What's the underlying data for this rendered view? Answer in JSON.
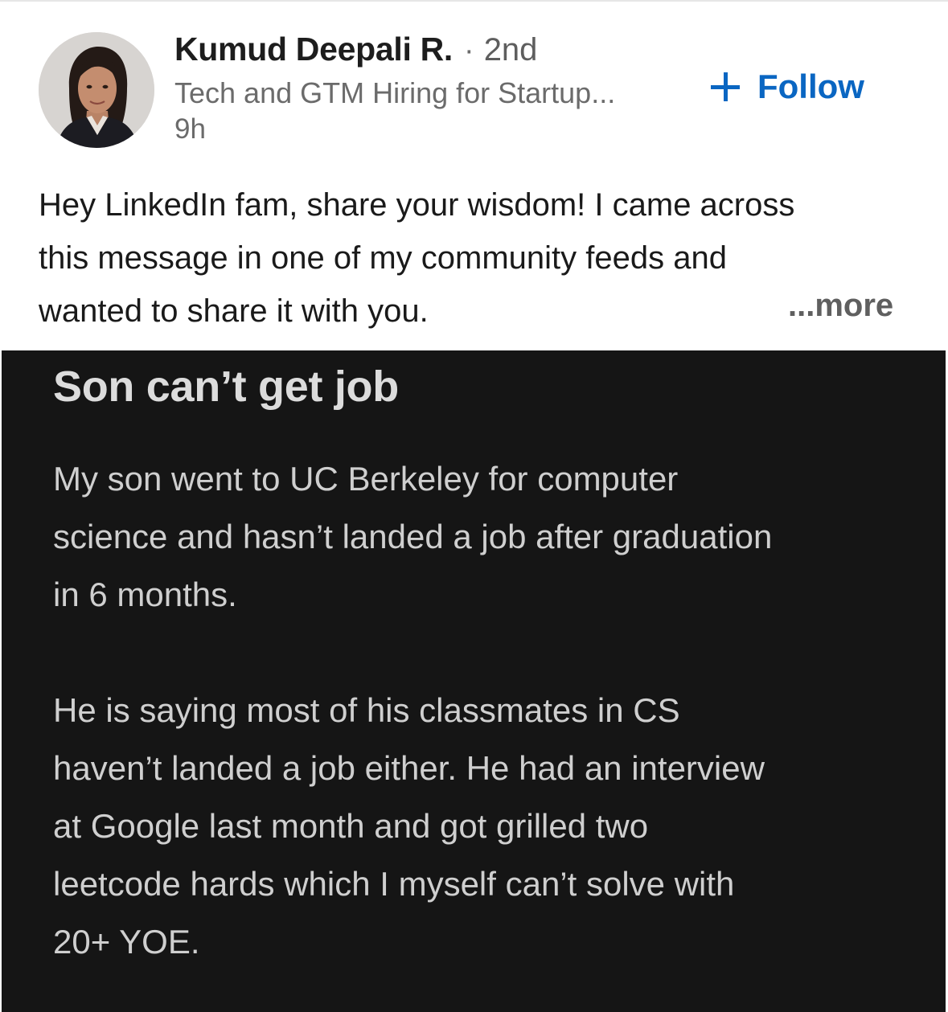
{
  "post": {
    "author": {
      "name": "Kumud Deepali R.",
      "separator": "·",
      "degree": "2nd",
      "headline": "Tech and GTM Hiring for Startup...",
      "time": "9h",
      "avatar_icon": "profile-photo"
    },
    "follow_label": "Follow",
    "follow_icon": "plus-icon",
    "text_lines": [
      "Hey LinkedIn fam, share your wisdom! I came across",
      "this message in one of my community feeds and",
      "wanted to share it with you."
    ],
    "see_more_label": "...more",
    "colors": {
      "accent": "#0a66c2",
      "image_background": "#151515"
    }
  },
  "image": {
    "title": "Son can’t get job",
    "paragraph1_lines": [
      "My son went to UC Berkeley for computer",
      "science and hasn’t landed a job after graduation",
      "in 6 months."
    ],
    "paragraph2_lines": [
      "He is saying most of his classmates in CS",
      "haven’t landed a job either. He had an interview",
      "at Google last month and got grilled two",
      "leetcode hards which I myself can’t solve with",
      "20+ YOE."
    ]
  }
}
